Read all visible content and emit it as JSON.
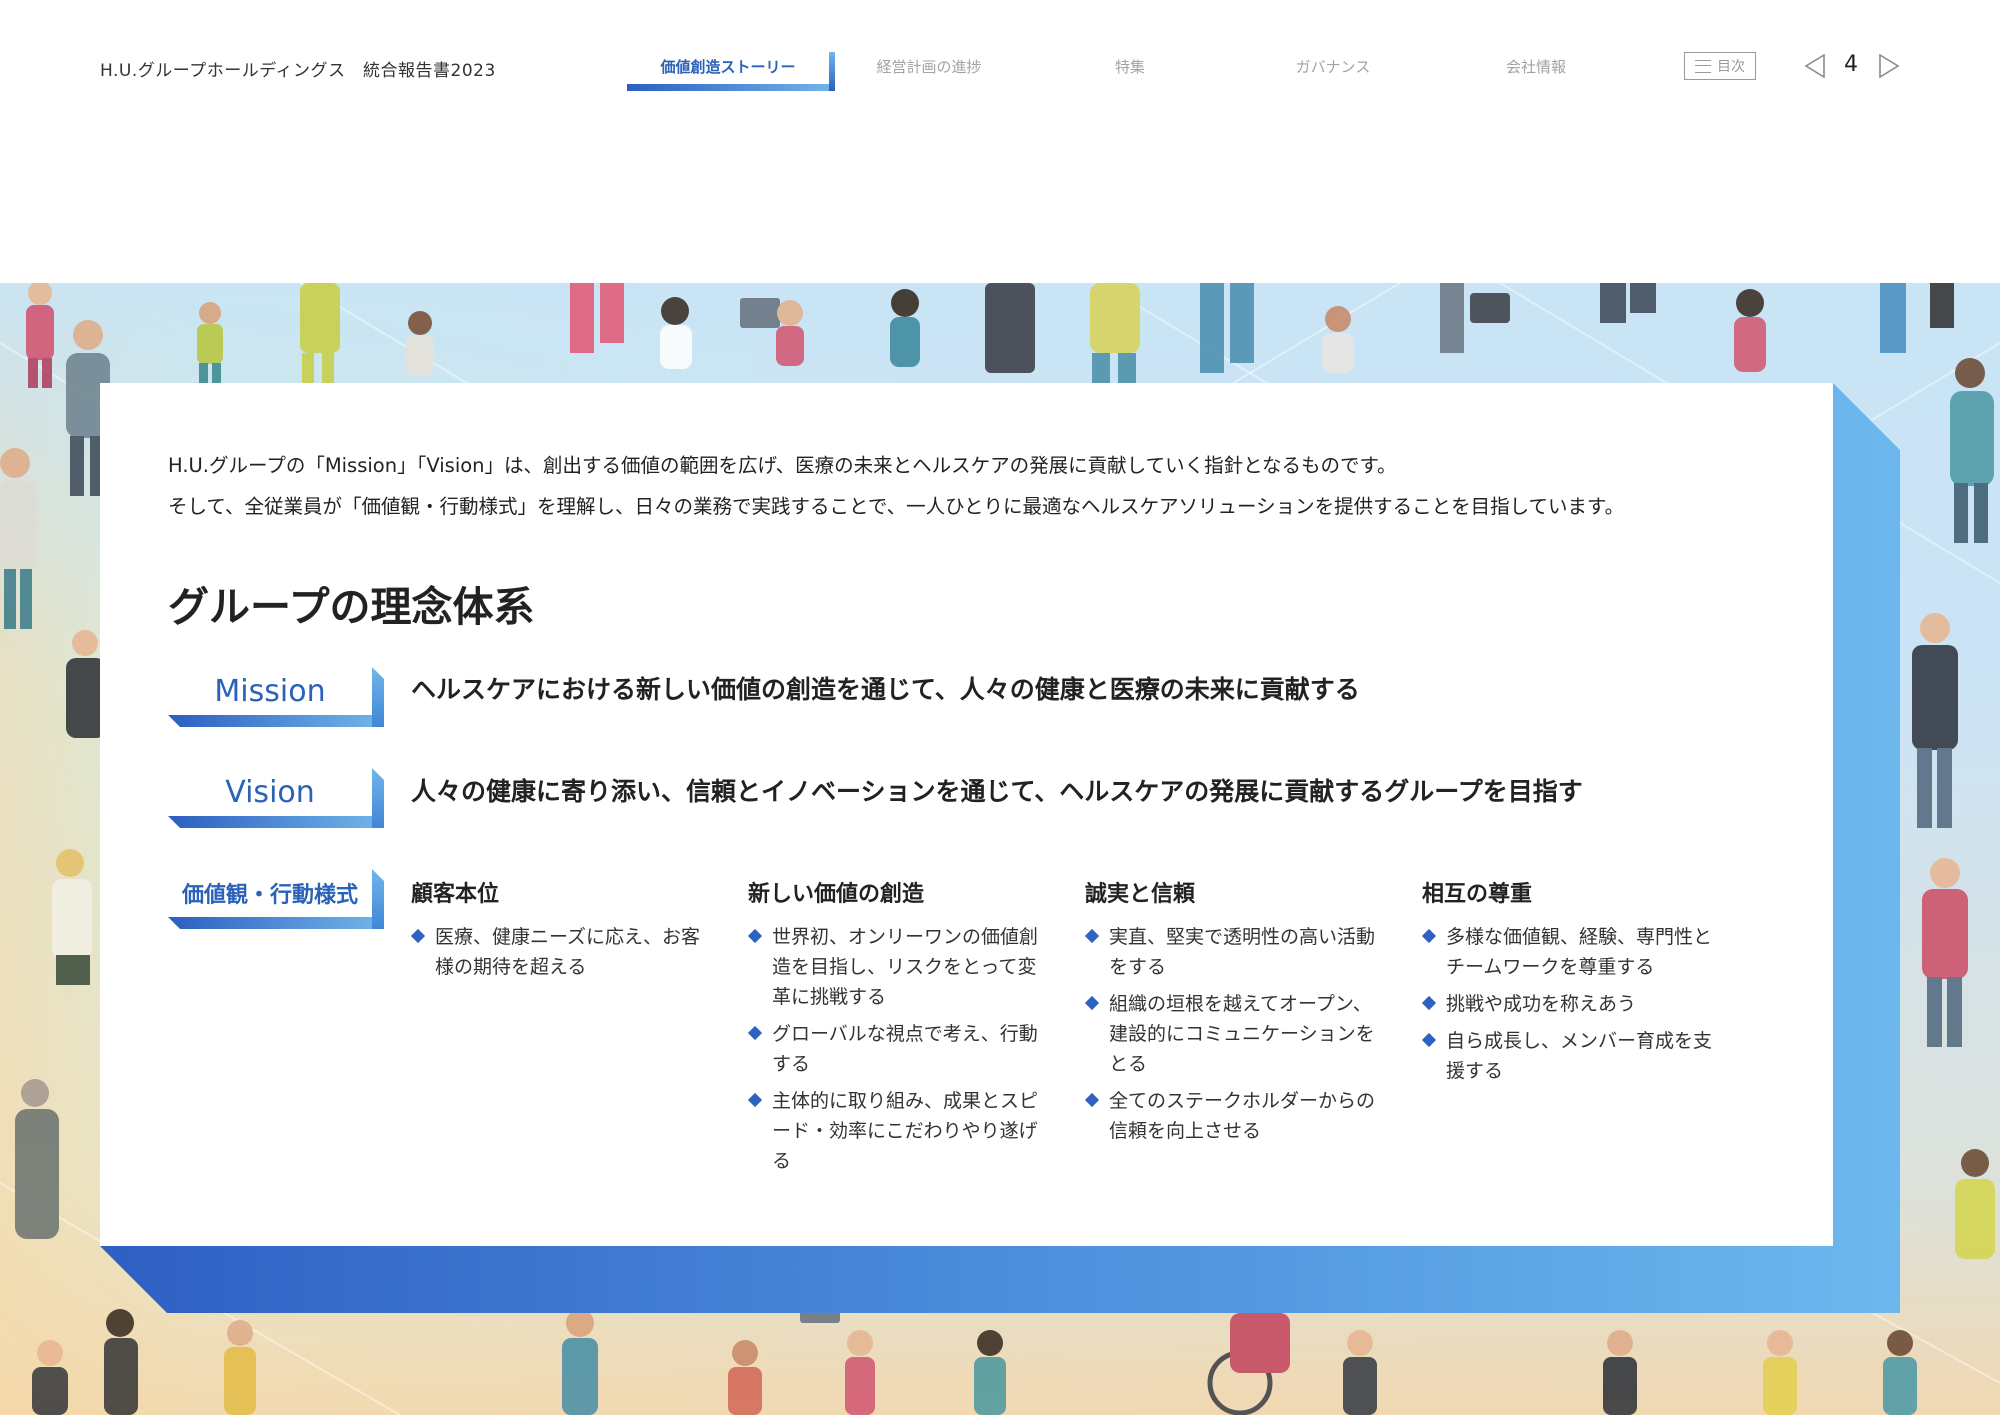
{
  "header": {
    "brand": "H.U.グループホールディングス　統合報告書2023",
    "tabs": [
      {
        "label": "価値創造ストーリー",
        "active": true
      },
      {
        "label": "経営計画の進捗",
        "active": false
      },
      {
        "label": "特集",
        "active": false
      },
      {
        "label": "ガバナンス",
        "active": false
      },
      {
        "label": "会社情報",
        "active": false
      }
    ],
    "toc_label": "目次",
    "page_number": "4"
  },
  "content": {
    "intro_lines": [
      "H.U.グループの「Mission」「Vision」は、創出する価値の範囲を広げ、医療の未来とヘルスケアの発展に貢献していく指針となるものです。",
      "そして、全従業員が「価値観・行動様式」を理解し、日々の業務で実践することで、一人ひとりに最適なヘルスケアソリューションを提供することを目指しています。"
    ],
    "section_title": "グループの理念体系",
    "mission": {
      "label": "Mission",
      "text": "ヘルスケアにおける新しい価値の創造を通じて、人々の健康と医療の未来に貢献する"
    },
    "vision": {
      "label": "Vision",
      "text": "人々の健康に寄り添い、信頼とイノベーションを通じて、ヘルスケアの発展に貢献するグループを目指す"
    },
    "values": {
      "label": "価値観・行動様式",
      "columns": [
        {
          "title": "顧客本位",
          "items": [
            "医療、健康ニーズに応え、お客様の期待を超える"
          ]
        },
        {
          "title": "新しい価値の創造",
          "items": [
            "世界初、オンリーワンの価値創造を目指し、リスクをとって変革に挑戦する",
            "グローバルな視点で考え、行動する",
            "主体的に取り組み、成果とスピード・効率にこだわりやり遂げる"
          ]
        },
        {
          "title": "誠実と信頼",
          "items": [
            "実直、堅実で透明性の高い活動をする",
            "組織の垣根を越えてオープン、建設的にコミュニケーションをとる",
            "全てのステークホルダーからの信頼を向上させる"
          ]
        },
        {
          "title": "相互の尊重",
          "items": [
            "多様な価値観、経験、専門性とチームワークを尊重する",
            "挑戦や成功を称えあう",
            "自ら成長し、メンバー育成を支援する"
          ]
        }
      ]
    }
  },
  "colors": {
    "accent": "#2a62b8",
    "gradient_light": "#72b6ea",
    "bullet": "#2f62c0"
  }
}
